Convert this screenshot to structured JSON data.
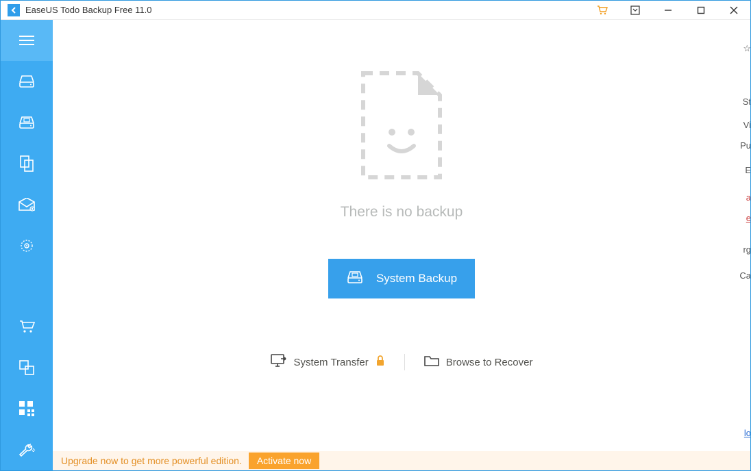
{
  "titlebar": {
    "product": "EaseUS Todo Backup Free 11.0"
  },
  "sidebar": {
    "items": [
      {
        "name": "menu"
      },
      {
        "name": "disk-backup"
      },
      {
        "name": "system-backup"
      },
      {
        "name": "file-backup"
      },
      {
        "name": "mail-backup"
      },
      {
        "name": "smart-backup"
      }
    ],
    "bottom": [
      {
        "name": "buy"
      },
      {
        "name": "clone"
      },
      {
        "name": "tools-grid"
      },
      {
        "name": "tools-wrench"
      }
    ]
  },
  "main": {
    "no_backup_text": "There is no backup",
    "system_backup_label": "System Backup",
    "system_transfer_label": "System Transfer",
    "browse_recover_label": "Browse to Recover"
  },
  "upgrade": {
    "text": "Upgrade now to get more powerful edition.",
    "button": "Activate now"
  },
  "background_fragments": [
    "St",
    "Vi",
    "Pu",
    "E",
    "a",
    "e",
    "rg",
    "Ca",
    "lo"
  ]
}
